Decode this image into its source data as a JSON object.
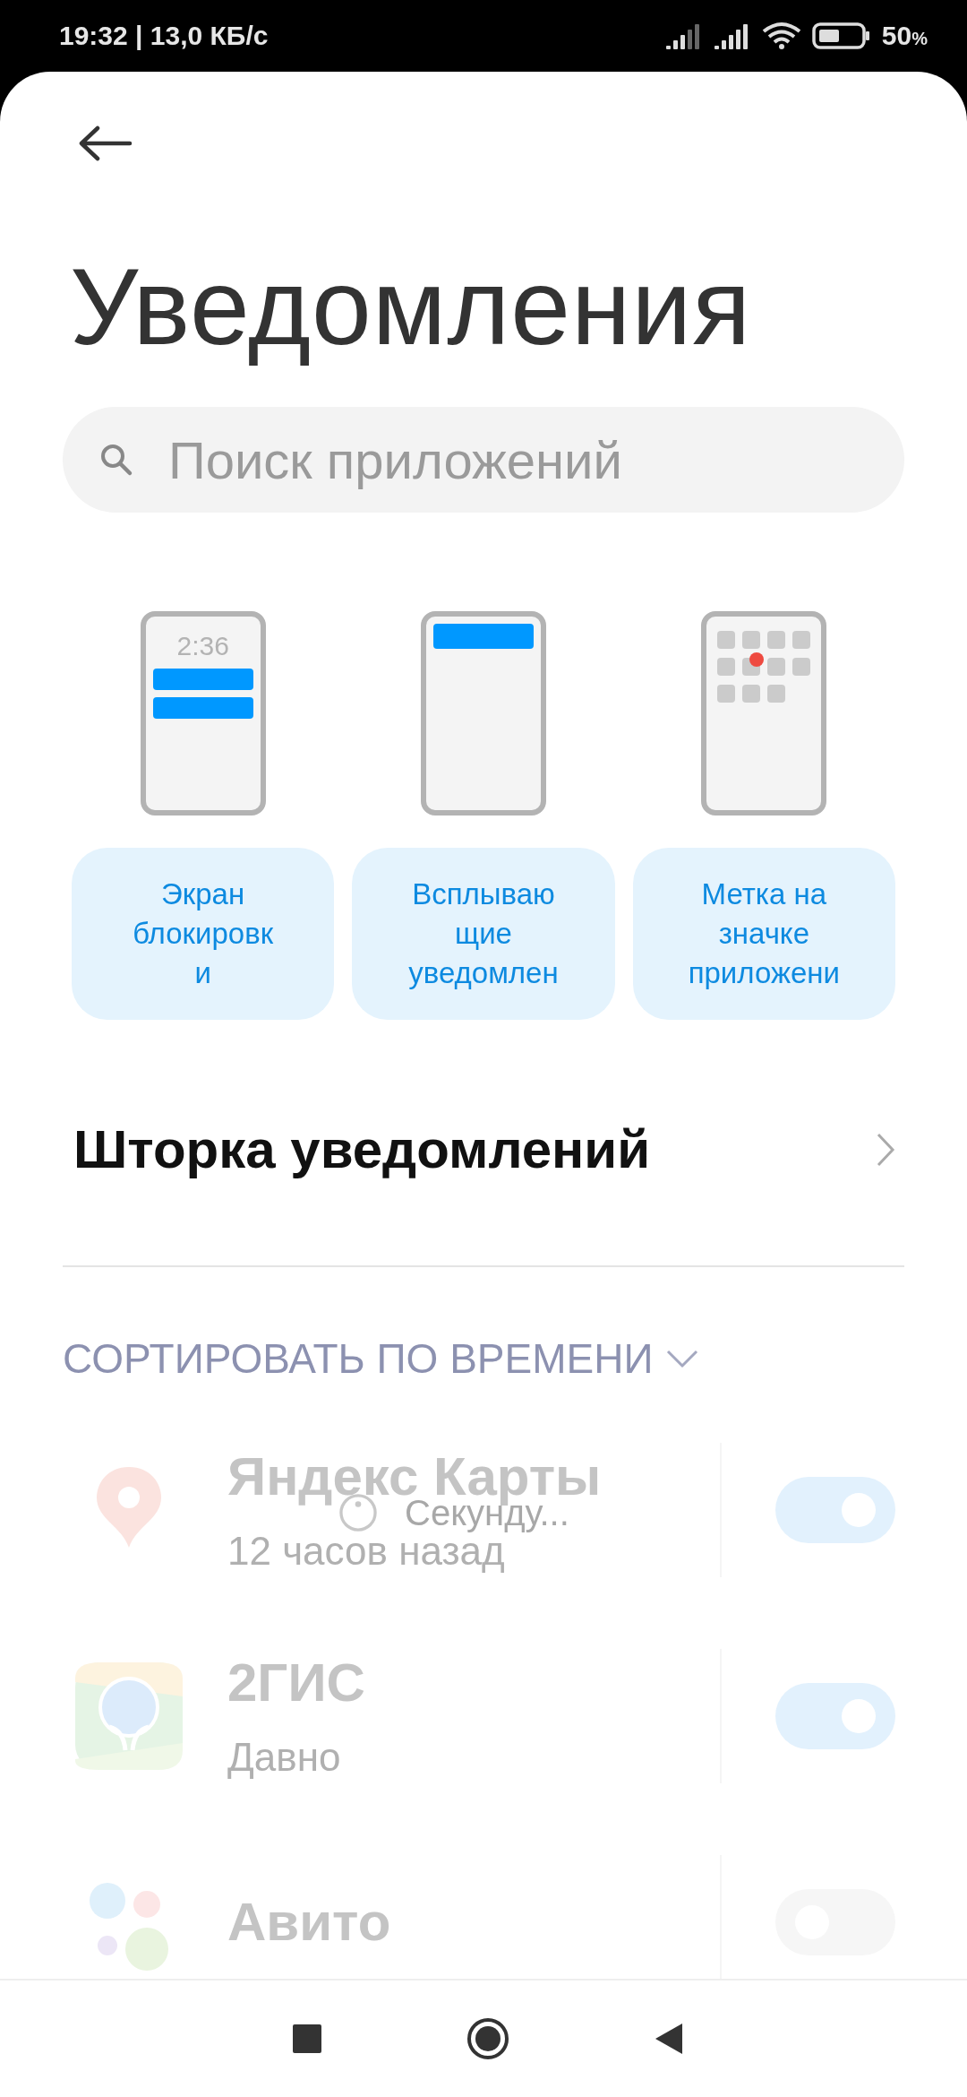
{
  "status_bar": {
    "time": "19:32 | 13,0 КБ/с",
    "battery": "50",
    "battery_unit": "%"
  },
  "title": "Уведомления",
  "search": {
    "placeholder": "Поиск приложений"
  },
  "styles": [
    {
      "kind": "lockscreen",
      "screen_time": "2:36",
      "label": "Экран\nблокировк\nи"
    },
    {
      "kind": "popup",
      "label": "Всплываю\nщие\nуведомлен"
    },
    {
      "kind": "badge",
      "label": "Метка на\nзначке\nприложени"
    }
  ],
  "shade_link": {
    "label": "Шторка уведомлений"
  },
  "sort": {
    "label": "СОРТИРОВАТЬ ПО ВРЕМЕНИ"
  },
  "apps": [
    {
      "kind": "pin",
      "name": "Яндекс Карты",
      "time": "12 часов назад",
      "on": true
    },
    {
      "kind": "map",
      "name": "2ГИС",
      "time": "Давно",
      "on": true
    },
    {
      "kind": "dots",
      "name": "Авито",
      "on": false
    }
  ],
  "loading": {
    "label": "Секунду..."
  }
}
